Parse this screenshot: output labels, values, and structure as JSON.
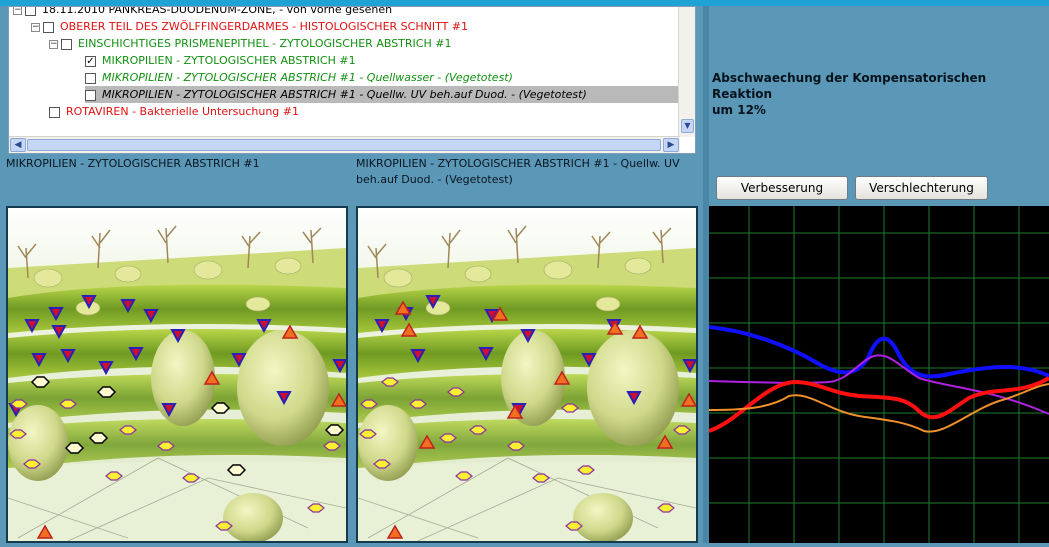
{
  "tree": {
    "items": [
      {
        "label": "18.11.2010 PANKREAS-DUODENUM-ZONE, - von vorne gesehen",
        "checked": false
      },
      {
        "label": "OBERER TEIL DES ZWÖLFFINGERDARMES - HISTOLOGISCHER SCHNITT #1",
        "checked": false
      },
      {
        "label": "EINSCHICHTIGES PRISMENEPITHEL - ZYTOLOGISCHER ABSTRICH #1",
        "checked": false
      },
      {
        "label": "MIKROPILIEN - ZYTOLOGISCHER ABSTRICH #1",
        "checked": true
      },
      {
        "label": "MIKROPILIEN - ZYTOLOGISCHER ABSTRICH #1 - Quellwasser - (Vegetotest)",
        "checked": false
      },
      {
        "label": "MIKROPILIEN - ZYTOLOGISCHER ABSTRICH #1 - Quellw. UV beh.auf Duod. - (Vegetotest)",
        "checked": false
      },
      {
        "label": "ROTAVIREN - Bakterielle Untersuchung #1",
        "checked": false
      }
    ]
  },
  "captions": {
    "left": "MIKROPILIEN - ZYTOLOGISCHER ABSTRICH #1",
    "right_line1": "MIKROPILIEN - ZYTOLOGISCHER ABSTRICH #1 - Quellw. UV",
    "right_line2": "beh.auf Duod. - (Vegetotest)"
  },
  "panel": {
    "message_line1": "Abschwaechung der Kompensatorischen Reaktion",
    "message_line2": "um 12%",
    "buttons": {
      "improve": "Verbesserung",
      "worsen": "Verschlechterung"
    }
  },
  "colors": {
    "accent": "#1fa2d4",
    "panel_bg": "#5b97b6",
    "tree_red": "#e01010",
    "tree_green": "#129012"
  },
  "graph": {
    "grid": true,
    "series_colors": [
      "#1010ff",
      "#b020e0",
      "#ff1010",
      "#f0902a"
    ]
  }
}
